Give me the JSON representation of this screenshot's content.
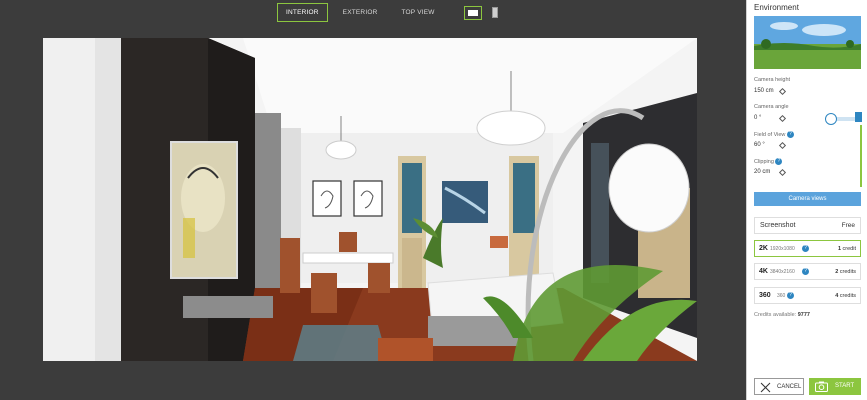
{
  "view_tabs": {
    "interior": "INTERIOR",
    "exterior": "EXTERIOR",
    "top_view": "TOP VIEW"
  },
  "panel": {
    "title": "Environment",
    "camera_height": {
      "label": "Camera height",
      "value": "150 cm"
    },
    "camera_angle": {
      "label": "Camera angle",
      "value": "0 °"
    },
    "field_of_view": {
      "label": "Field of View",
      "value": "60 °",
      "help": "?"
    },
    "clipping": {
      "label": "Clipping",
      "value": "20 cm",
      "help": "?"
    },
    "camera_views_label": "Camera views",
    "screenshot": {
      "title": "Screenshot",
      "free_label": "Free"
    },
    "resolutions": [
      {
        "name": "2K",
        "dims": "1920x1080",
        "help": "?",
        "credit_num": "1",
        "credit_word": "credit"
      },
      {
        "name": "4K",
        "dims": "3840x2160",
        "help": "?",
        "credit_num": "2",
        "credit_word": "credits"
      },
      {
        "name": "360",
        "dims": "360",
        "help": "?",
        "credit_num": "4",
        "credit_word": "credits"
      }
    ],
    "credits_available_label": "Credits available:",
    "credits_available_value": "9777",
    "cancel_label": "CANCEL",
    "start_label": "START"
  },
  "colors": {
    "accent_green": "#8cc63f",
    "accent_blue": "#5ba3dc",
    "help_blue": "#2e86c1",
    "app_background": "#3c3c3c"
  },
  "icons": {
    "cancel": "close-icon",
    "start": "camera-icon",
    "help": "help-icon"
  }
}
